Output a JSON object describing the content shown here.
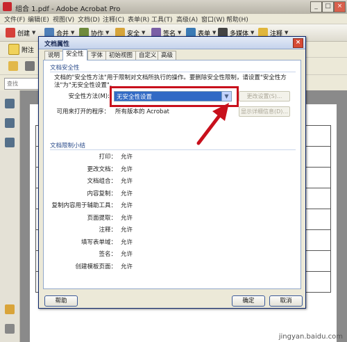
{
  "window": {
    "title": "组合 1.pdf - Adobe Acrobat Pro"
  },
  "menu": [
    "文件(F)",
    "编辑(E)",
    "视图(V)",
    "文档(D)",
    "注释(C)",
    "表单(R)",
    "工具(T)",
    "高级(A)",
    "窗口(W)",
    "帮助(H)"
  ],
  "toolbar": {
    "create": "创建",
    "combine": "合并",
    "collaborate": "协作",
    "secure": "安全",
    "sign": "签名",
    "forms": "表单",
    "multimedia": "多媒体",
    "comment": "注释",
    "attach": "附注"
  },
  "search": {
    "placeholder": "查找"
  },
  "dialog": {
    "title": "文档属性",
    "tabs": [
      "说明",
      "安全性",
      "字体",
      "初始视图",
      "自定义",
      "高级"
    ],
    "active_tab": "安全性",
    "security_section": "文档安全性",
    "description": "文档的\"安全性方法\"用于限制对文档所执行的操作。要删除安全性限制，请设置\"安全性方法\"为\"无安全性设置\"。",
    "method_label": "安全性方法(M):",
    "method_value": "无安全性设置",
    "change_settings": "更改设置(S)...",
    "openable_label": "可用来打开的程序：",
    "openable_value": "所有版本的 Acrobat",
    "show_details": "显示详细信息(D)...",
    "restrictions_section": "文档限制小结",
    "restrictions": [
      {
        "label": "打印：",
        "value": "允许"
      },
      {
        "label": "更改文档：",
        "value": "允许"
      },
      {
        "label": "文档组合：",
        "value": "允许"
      },
      {
        "label": "内容复制：",
        "value": "允许"
      },
      {
        "label": "复制内容用于辅助工具：",
        "value": "允许"
      },
      {
        "label": "页面提取：",
        "value": "允许"
      },
      {
        "label": "注释：",
        "value": "允许"
      },
      {
        "label": "填写表单域：",
        "value": "允许"
      },
      {
        "label": "签名：",
        "value": "允许"
      },
      {
        "label": "创建模板页面：",
        "value": "允许"
      }
    ],
    "help": "帮助",
    "ok": "确定",
    "cancel": "取消"
  },
  "watermark": "jingyan.baidu.com",
  "colors": {
    "highlight": "#c8101c",
    "select": "#316ac5"
  }
}
